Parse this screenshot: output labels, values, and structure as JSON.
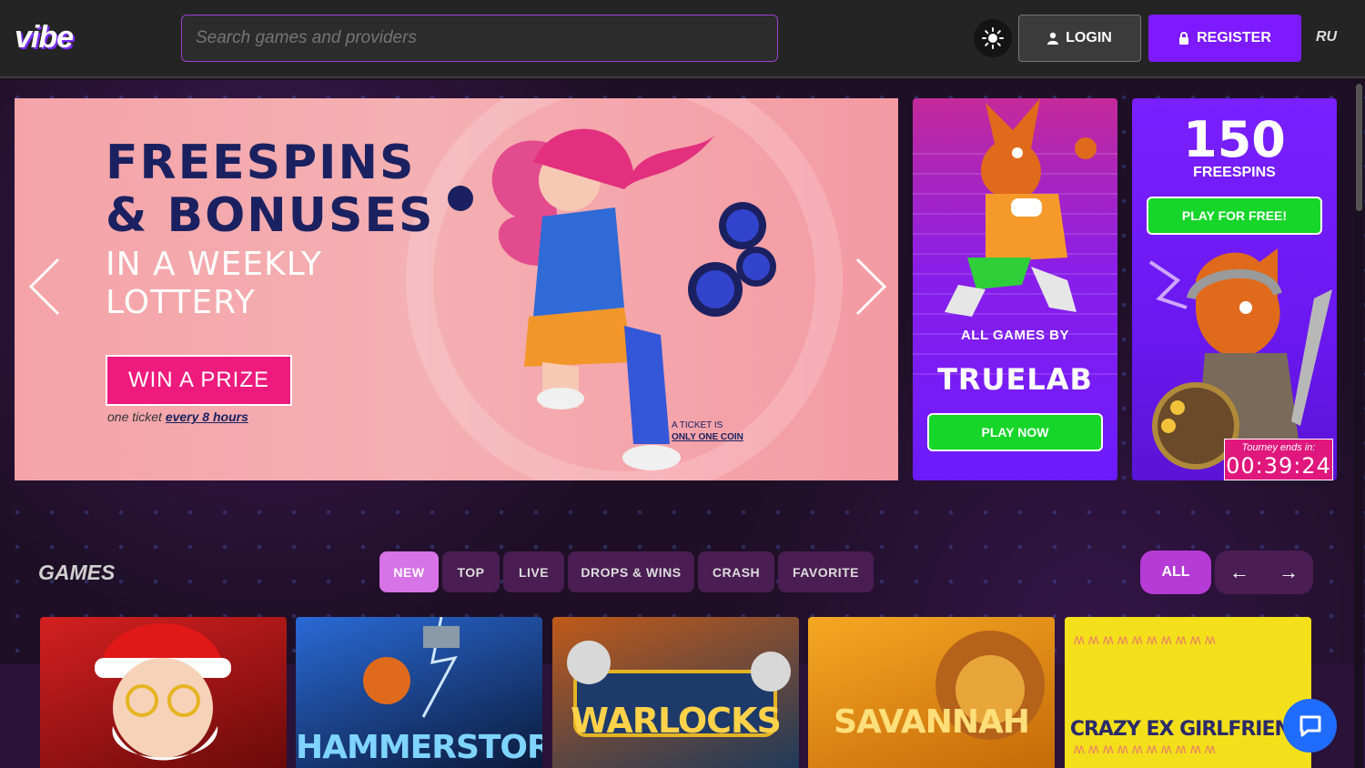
{
  "header": {
    "logo": "vibe",
    "search_placeholder": "Search games and providers",
    "login_label": "LOGIN",
    "register_label": "REGISTER",
    "lang": "RU"
  },
  "hero": {
    "title_line1": "FREESPINS",
    "title_line2": "& BONUSES",
    "sub_line1": "IN A WEEKLY",
    "sub_line2": "LOTTERY",
    "cta": "WIN A PRIZE",
    "note_prefix": "one ticket",
    "note_link": "every 8 hours",
    "ticket_line1": "A TICKET IS",
    "ticket_line2": "ONLY ONE COIN"
  },
  "promo1": {
    "label": "ALL GAMES BY",
    "brand": "TRUELAB",
    "button": "PLAY NOW"
  },
  "promo2": {
    "number": "150",
    "label": "FREESPINS",
    "button": "PLAY FOR FREE!",
    "tourney_label": "Tourney ends in:",
    "tourney_time": "00:39:24"
  },
  "games": {
    "title": "GAMES",
    "tabs": [
      "NEW",
      "TOP",
      "LIVE",
      "DROPS & WINS",
      "CRASH",
      "FAVORITE"
    ],
    "all_label": "ALL",
    "prev": "←",
    "next": "→",
    "cards": [
      {
        "title": "",
        "colors": [
          "#c81818",
          "#6a0a0a"
        ]
      },
      {
        "title": "HAMMERSTORM",
        "colors": [
          "#1a4aa0",
          "#0b1a3a"
        ]
      },
      {
        "title": "WARLOCKS",
        "colors": [
          "#b84a12",
          "#1f3a5a"
        ]
      },
      {
        "title": "SAVANNAH",
        "colors": [
          "#f0a01e",
          "#c56a08"
        ]
      },
      {
        "title": "CRAZY EX GIRLFRIEND",
        "colors": [
          "#f4e01a",
          "#f0c80a"
        ]
      }
    ]
  },
  "colors": {
    "accent": "#7d1aff",
    "pink": "#ee1a7d",
    "green": "#17d62a",
    "tab_active": "#d673e6"
  }
}
